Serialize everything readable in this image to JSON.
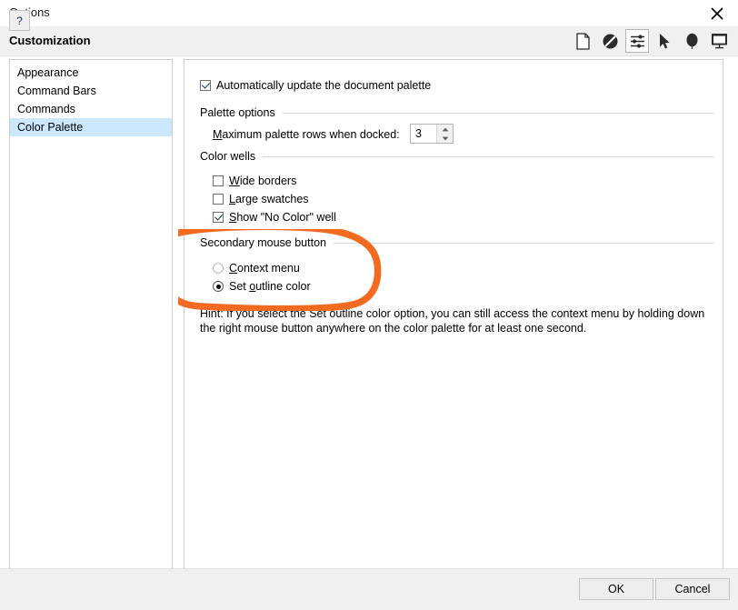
{
  "window": {
    "title": "Options",
    "close_icon": "close-x-icon"
  },
  "header": {
    "title": "Customization",
    "icons": [
      {
        "name": "document-page-icon",
        "selected": false
      },
      {
        "name": "no-color-icon",
        "selected": false
      },
      {
        "name": "sliders-customization-icon",
        "selected": true
      },
      {
        "name": "cursor-arrow-icon",
        "selected": false
      },
      {
        "name": "balloon-pin-icon",
        "selected": false
      },
      {
        "name": "display-monitor-icon",
        "selected": false
      }
    ]
  },
  "sidebar": {
    "items": [
      {
        "label": "Appearance",
        "selected": false
      },
      {
        "label": "Command Bars",
        "selected": false
      },
      {
        "label": "Commands",
        "selected": false
      },
      {
        "label": "Color Palette",
        "selected": true
      }
    ]
  },
  "content": {
    "auto_update": {
      "label": "Automatically update the document palette",
      "checked": true
    },
    "palette_options": {
      "group_label": "Palette options",
      "max_rows": {
        "label_prefix": "",
        "label_accel": "M",
        "label_rest": "aximum palette rows when docked:",
        "value": "3"
      }
    },
    "color_wells": {
      "group_label": "Color wells",
      "items": [
        {
          "accel": "W",
          "rest": "ide borders",
          "checked": false
        },
        {
          "accel": "L",
          "rest": "arge swatches",
          "checked": false
        },
        {
          "accel": "S",
          "rest": "how \"No Color\" well",
          "checked": true
        }
      ]
    },
    "secondary_mouse": {
      "group_label": "Secondary mouse button",
      "options": [
        {
          "prefix": "",
          "accel": "C",
          "rest": "ontext menu",
          "selected": false
        },
        {
          "prefix": "Set ",
          "accel": "o",
          "rest": "utline color",
          "selected": true
        }
      ]
    },
    "hint": "Hint: If you select the Set outline color option, you can still access the context menu by holding down the right mouse button anywhere on the color palette for at least one second."
  },
  "footer": {
    "help_label": "?",
    "ok_label": "OK",
    "cancel_label": "Cancel"
  },
  "annotation": {
    "name": "orange-highlight-ellipse",
    "color": "#F26B21"
  }
}
